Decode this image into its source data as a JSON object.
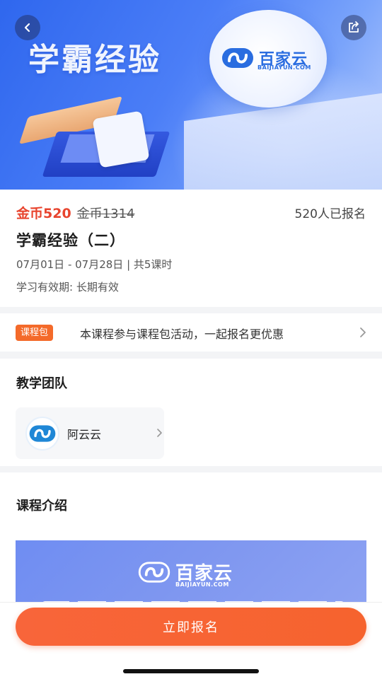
{
  "header": {
    "banner_title": "学霸经验",
    "brand_name": "百家云",
    "brand_domain": "BAIJIAYUN.COM",
    "back_icon": "chevron-left-icon",
    "share_icon": "share-icon"
  },
  "course": {
    "price": "金币520",
    "original_price": "金币1314",
    "enrolled": "520人已报名",
    "title": "学霸经验（二）",
    "schedule": "07月01日 - 07月28日 | 共5课时",
    "validity": "学习有效期: 长期有效"
  },
  "package": {
    "tag": "课程包",
    "text": "本课程参与课程包活动，一起报名更优惠"
  },
  "team": {
    "title": "教学团队",
    "teacher_name": "阿云云"
  },
  "intro": {
    "title": "课程介绍",
    "brand_name": "百家云",
    "brand_domain": "BAIJIAYUN.COM"
  },
  "actions": {
    "enroll_label": "立即报名"
  },
  "colors": {
    "accent_orange": "#f6632e",
    "price_red": "#e8452f",
    "brand_blue": "#2a6de0"
  }
}
